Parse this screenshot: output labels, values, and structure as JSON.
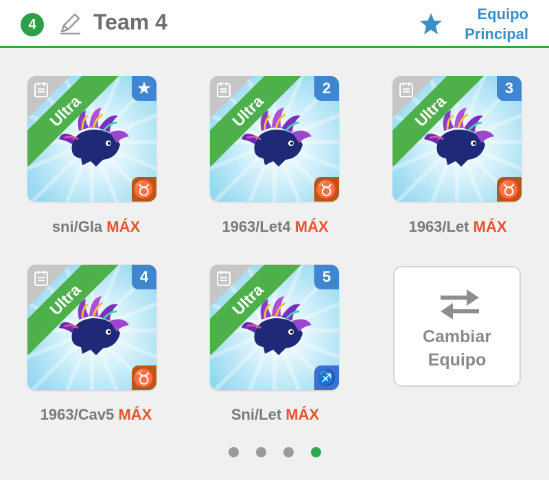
{
  "header": {
    "team_number": "4",
    "team_name": "Team 4",
    "main_team_label_line1": "Equipo",
    "main_team_label_line2": "Principal",
    "accent_color": "#3aa34a",
    "link_color": "#3a8fc8"
  },
  "cards": [
    {
      "ribbon": "Ultra",
      "badge": "★",
      "badge_type": "star",
      "zodiac": "♉",
      "zodiac_type": "taurus",
      "name": "sni/Gla",
      "max_label": "MÁX"
    },
    {
      "ribbon": "Ultra",
      "badge": "2",
      "badge_type": "number",
      "zodiac": "♉",
      "zodiac_type": "taurus",
      "name": "1963/Let4",
      "max_label": "MÁX"
    },
    {
      "ribbon": "Ultra",
      "badge": "3",
      "badge_type": "number",
      "zodiac": "♉",
      "zodiac_type": "taurus",
      "name": "1963/Let",
      "max_label": "MÁX"
    },
    {
      "ribbon": "Ultra",
      "badge": "4",
      "badge_type": "number",
      "zodiac": "♉",
      "zodiac_type": "taurus",
      "name": "1963/Cav5",
      "max_label": "MÁX"
    },
    {
      "ribbon": "Ultra",
      "badge": "5",
      "badge_type": "number",
      "zodiac": "♐",
      "zodiac_type": "sagittarius",
      "name": "Sni/Let",
      "max_label": "MÁX"
    }
  ],
  "switch_team": {
    "line1": "Cambiar",
    "line2": "Equipo",
    "icon": "swap-arrows-icon"
  },
  "pagination": {
    "pages": 4,
    "active": 4
  }
}
